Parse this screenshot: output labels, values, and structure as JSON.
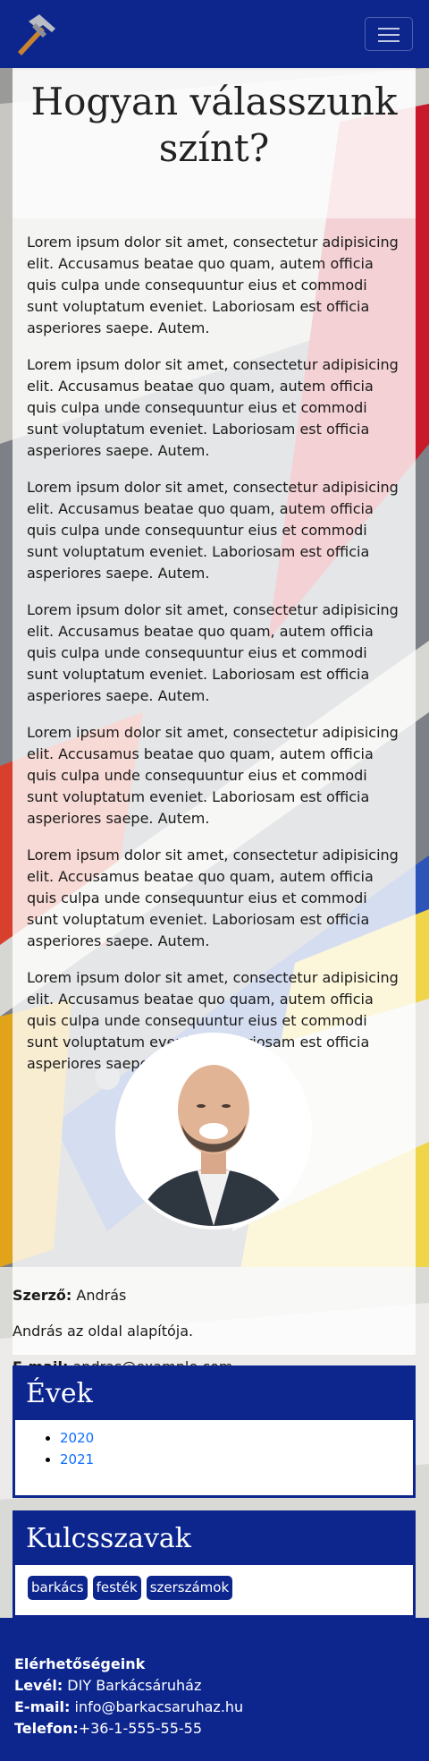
{
  "navbar": {
    "logo_icon": "hammer-icon",
    "menu_icon": "hamburger-icon"
  },
  "article": {
    "title": "Hogyan válasszunk színt?",
    "paragraphs": [
      "Lorem ipsum dolor sit amet, consectetur adipisicing elit. Accusamus beatae quo quam, autem officia quis culpa unde consequuntur eius et commodi sunt voluptatum eveniet. Laboriosam est officia asperiores saepe. Autem.",
      "Lorem ipsum dolor sit amet, consectetur adipisicing elit. Accusamus beatae quo quam, autem officia quis culpa unde consequuntur eius et commodi sunt voluptatum eveniet. Laboriosam est officia asperiores saepe. Autem.",
      "Lorem ipsum dolor sit amet, consectetur adipisicing elit. Accusamus beatae quo quam, autem officia quis culpa unde consequuntur eius et commodi sunt voluptatum eveniet. Laboriosam est officia asperiores saepe. Autem.",
      "Lorem ipsum dolor sit amet, consectetur adipisicing elit. Accusamus beatae quo quam, autem officia quis culpa unde consequuntur eius et commodi sunt voluptatum eveniet. Laboriosam est officia asperiores saepe. Autem.",
      "Lorem ipsum dolor sit amet, consectetur adipisicing elit. Accusamus beatae quo quam, autem officia quis culpa unde consequuntur eius et commodi sunt voluptatum eveniet. Laboriosam est officia asperiores saepe. Autem.",
      "Lorem ipsum dolor sit amet, consectetur adipisicing elit. Accusamus beatae quo quam, autem officia quis culpa unde consequuntur eius et commodi sunt voluptatum eveniet. Laboriosam est officia asperiores saepe. Autem.",
      "Lorem ipsum dolor sit amet, consectetur adipisicing elit. Accusamus beatae quo quam, autem officia quis culpa unde consequuntur eius et commodi sunt voluptatum eveniet. Laboriosam est officia asperiores saepe. Autem."
    ],
    "author": {
      "label": "Szerző:",
      "name": " András",
      "bio": "András az oldal alapítója.",
      "email_label": "E-mail:",
      "email": " andras@example.com"
    }
  },
  "years": {
    "title": "Évek",
    "items": [
      "2020",
      "2021"
    ]
  },
  "keywords": {
    "title": "Kulcsszavak",
    "tags": [
      "barkács",
      "festék",
      "szerszámok"
    ]
  },
  "footer": {
    "heading": "Elérhetőségeink",
    "mail_label": "Levél:",
    "mail_value": " DIY Barkácsáruház",
    "email_label": "E-mail:",
    "email_value": " info@barkacsaruhaz.hu",
    "phone_label": "Telefon:",
    "phone_value": "+36-1-555-55-55"
  },
  "colors": {
    "brand": "#0d268e",
    "link": "#0d6efd"
  }
}
